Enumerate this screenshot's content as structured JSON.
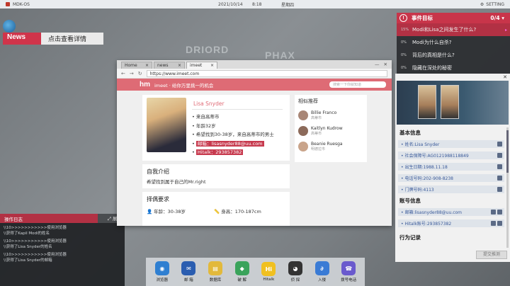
{
  "topbar": {
    "os_name": "MDK-OS",
    "date": "2021/10/14",
    "time": "8:18",
    "weekday": "星期四",
    "setting": "SETTING"
  },
  "map": {
    "labels": [
      "DRIORD",
      "PHAX"
    ]
  },
  "news": {
    "label": "News",
    "link": "点击查看详情"
  },
  "log": {
    "title": "操作日志",
    "expand": "展开",
    "entries": [
      [
        "\\\\10>>>>>>>>>>>使用浏览器",
        "\\\\获得了Kapil Modi的姓名"
      ],
      [
        "\\\\10>>>>>>>>>>>使用浏览器",
        "\\\\获得了Lisa Snyder的姓名"
      ],
      [
        "\\\\10>>>>>>>>>>>使用浏览器",
        "\\\\获得了Lisa Snyder的邮箱"
      ]
    ]
  },
  "browser": {
    "tabs": [
      {
        "label": "Home",
        "close": "×"
      },
      {
        "label": "news",
        "close": "×"
      },
      {
        "label": "imeet",
        "close": "×"
      }
    ],
    "url": "https://www.imeet.com",
    "site_logo": "hm",
    "site_slogan": "imeet · 给你万里挑一的机会",
    "search_placeholder": "搜索一下你就知道"
  },
  "profile": {
    "name": "Lisa Snyder",
    "info": [
      "来自高蒂市",
      "年龄32岁",
      "希望找到30-38岁，来自高蒂市的男士"
    ],
    "email": "邮箱：lisasnyder88@uu.com",
    "hitalk": "Hitalk：293857382"
  },
  "similar": {
    "title": "相似推荐",
    "people": [
      {
        "name": "Billie Franco",
        "city": "高蒂市",
        "color": "#a88676"
      },
      {
        "name": "Kaitlyn Kudrow",
        "city": "高蒂市",
        "color": "#8c6a5a"
      },
      {
        "name": "Beanie Ruesga",
        "city": "明德拉市",
        "color": "#c9a48a"
      }
    ]
  },
  "intro": {
    "title": "自我介绍",
    "text": "希望找到属于自己的Mr.right"
  },
  "requirements": {
    "title": "择偶要求",
    "age": "年龄：30-38岁",
    "height": "身高：170-187cm"
  },
  "events": {
    "title": "事件目标",
    "count": "0/4",
    "items": [
      {
        "pct": "15%",
        "text": "Modi和Lisa之间发生了什么?",
        "active": true
      },
      {
        "pct": "0%",
        "text": "Modi为什么自杀?",
        "active": false
      },
      {
        "pct": "0%",
        "text": "背后的真相是什么?",
        "active": false
      },
      {
        "pct": "0%",
        "text": "隐藏在深处的秘密",
        "active": false
      }
    ]
  },
  "dossier": {
    "basic_title": "基本信息",
    "basic": [
      "• 姓名:Lisa Snyder",
      "• 社会保障号:AG0121988118849",
      "• 出生日期:1988.11.18",
      "• 电话号码:202-908-8238",
      "• 门牌号码:4113"
    ],
    "account_title": "账号信息",
    "account": [
      "• 邮箱:lisasnyder88@uu.com",
      "• Hitalk账号:293857382"
    ],
    "record_title": "行为记录",
    "submit": "提交推测"
  },
  "dock": [
    {
      "label": "浏览器",
      "icon": "globe-icon",
      "color": "#2f7fd1"
    },
    {
      "label": "邮 箱",
      "icon": "mail-icon",
      "color": "#2a5db0"
    },
    {
      "label": "数据库",
      "icon": "database-icon",
      "color": "#e2b93b"
    },
    {
      "label": "破 解",
      "icon": "crack-icon",
      "color": "#3aa35b"
    },
    {
      "label": "Hitalk",
      "icon": "hitalk-icon",
      "color": "#f0c020"
    },
    {
      "label": "侦 探",
      "icon": "detective-icon",
      "color": "#333333"
    },
    {
      "label": "入侵",
      "icon": "hack-icon",
      "color": "#3a7bd5"
    },
    {
      "label": "拨号电话",
      "icon": "phone-icon",
      "color": "#6a5acd"
    }
  ]
}
